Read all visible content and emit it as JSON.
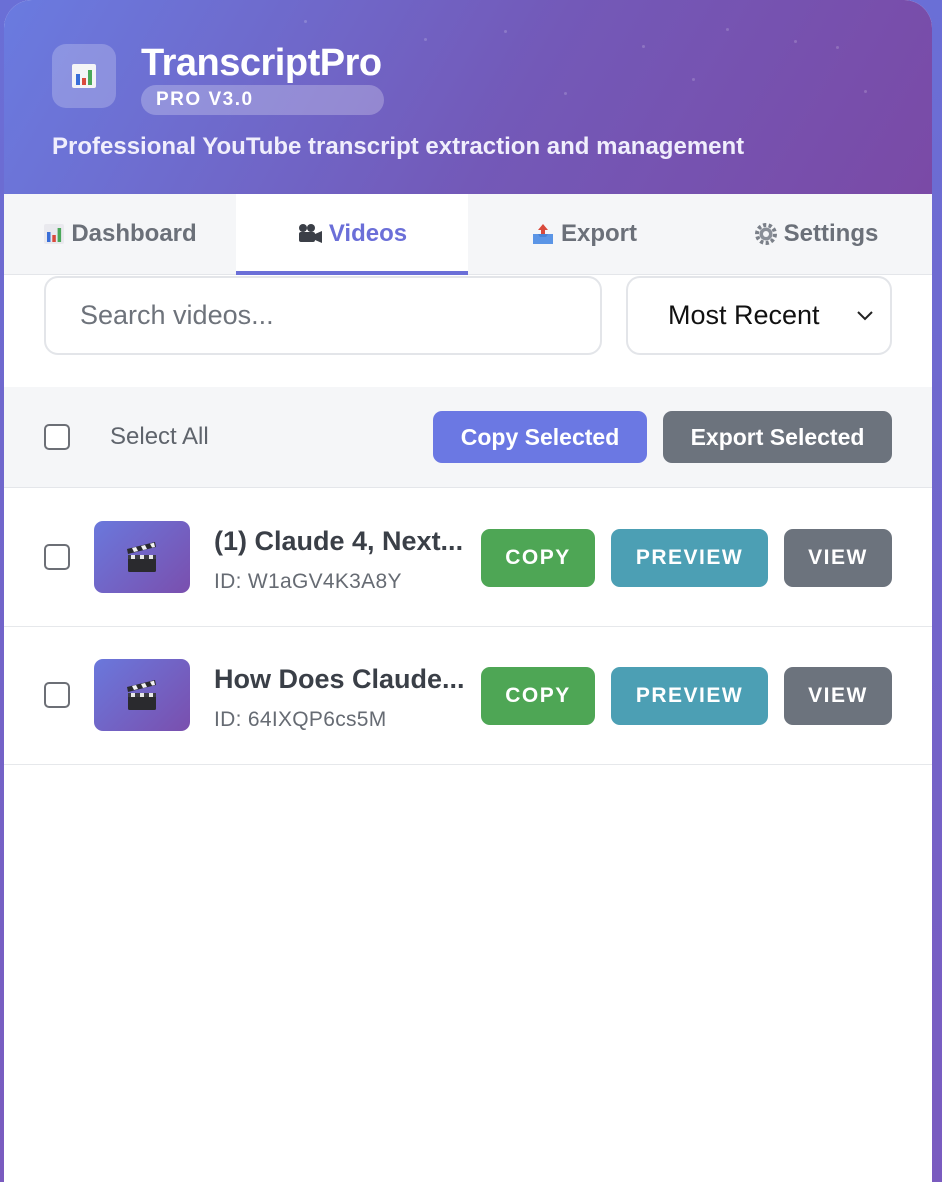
{
  "header": {
    "logo_icon": "bar-chart-icon",
    "title": "TranscriptPro",
    "version_badge": "PRO V3.0",
    "tagline": "Professional YouTube transcript extraction and management"
  },
  "tabs": [
    {
      "label": "Dashboard",
      "icon": "bar-chart-icon",
      "active": false
    },
    {
      "label": "Videos",
      "icon": "movie-camera-icon",
      "active": true
    },
    {
      "label": "Export",
      "icon": "outbox-tray-icon",
      "active": false
    },
    {
      "label": "Settings",
      "icon": "gear-icon",
      "active": false
    }
  ],
  "search": {
    "placeholder": "Search videos...",
    "value": ""
  },
  "sort": {
    "selected": "Most Recent"
  },
  "bulk": {
    "select_all_label": "Select All",
    "copy_selected_label": "Copy Selected",
    "export_selected_label": "Export Selected"
  },
  "videos": [
    {
      "title": "(1) Claude 4, Next...",
      "id_text": "ID: W1aGV4K3A8Y",
      "thumb_icon": "clapper-board-icon",
      "copy_label": "COPY",
      "preview_label": "PREVIEW",
      "view_label": "VIEW"
    },
    {
      "title": "How Does Claude...",
      "id_text": "ID: 64IXQP6cs5M",
      "thumb_icon": "clapper-board-icon",
      "copy_label": "COPY",
      "preview_label": "PREVIEW",
      "view_label": "VIEW"
    }
  ],
  "colors": {
    "accent": "#6b6fd8",
    "copy_green": "#4ea655",
    "preview_teal": "#4c9fb4",
    "view_gray": "#6c737d"
  }
}
